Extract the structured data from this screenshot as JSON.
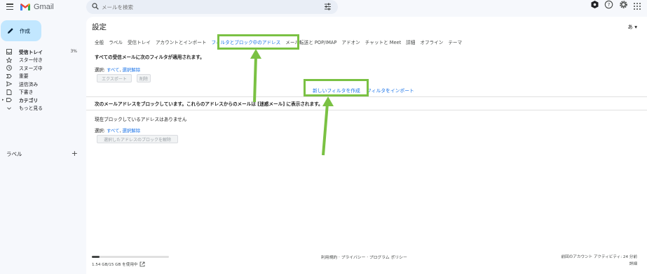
{
  "app": {
    "brand": "Gmail"
  },
  "search": {
    "placeholder": "メールを検索"
  },
  "sidebar": {
    "compose_label": "作成",
    "items": [
      {
        "label": "受信トレイ",
        "count": "3%",
        "bold": true
      },
      {
        "label": "スター付き"
      },
      {
        "label": "スヌーズ中"
      },
      {
        "label": "重要"
      },
      {
        "label": "送信済み"
      },
      {
        "label": "下書き"
      },
      {
        "label": "カテゴリ",
        "bold": true
      },
      {
        "label": "もっと見る"
      }
    ],
    "labels_heading": "ラベル",
    "labels_add": "+"
  },
  "settings": {
    "title": "設定",
    "lang_badge": "あ ▾",
    "tabs": [
      "全般",
      "ラベル",
      "受信トレイ",
      "アカウントとインポート",
      "フィルタとブロック中のアドレス",
      "メール転送と POP/IMAP",
      "アドオン",
      "チャットと Meet",
      "詳細",
      "オフライン",
      "テーマ"
    ],
    "active_tab_index": 4,
    "filters": {
      "heading": "すべての受信メールに次のフィルタが適用されます。",
      "select_prefix": "選択:",
      "select_all": "すべて",
      "select_none": "選択解除",
      "export_button": "エクスポート",
      "delete_button": "削除",
      "create_filter": "新しいフィルタを作成",
      "import_filter": "フィルタをインポート"
    },
    "blocked": {
      "heading": "次のメールアドレスをブロックしています。これらのアドレスからのメールは [迷惑メール] に表示されます。",
      "empty_text": "現在ブロックしているアドレスはありません",
      "select_prefix": "選択:",
      "select_all": "すべて",
      "select_none": "選択解除",
      "unblock_button": "選択したアドレスのブロックを解除"
    }
  },
  "footer": {
    "storage_text": "1.54 GB/15 GB を使用中",
    "storage_fraction": 0.103,
    "links": "利用規約 · プライバシー · プログラム ポリシー",
    "last_activity": "前回のアカウント アクティビティ: 24 分前",
    "details": "詳細"
  },
  "colors": {
    "accent": "#1a73e8",
    "compose_bg": "#c2e7ff",
    "annotation": "#7ac143"
  }
}
